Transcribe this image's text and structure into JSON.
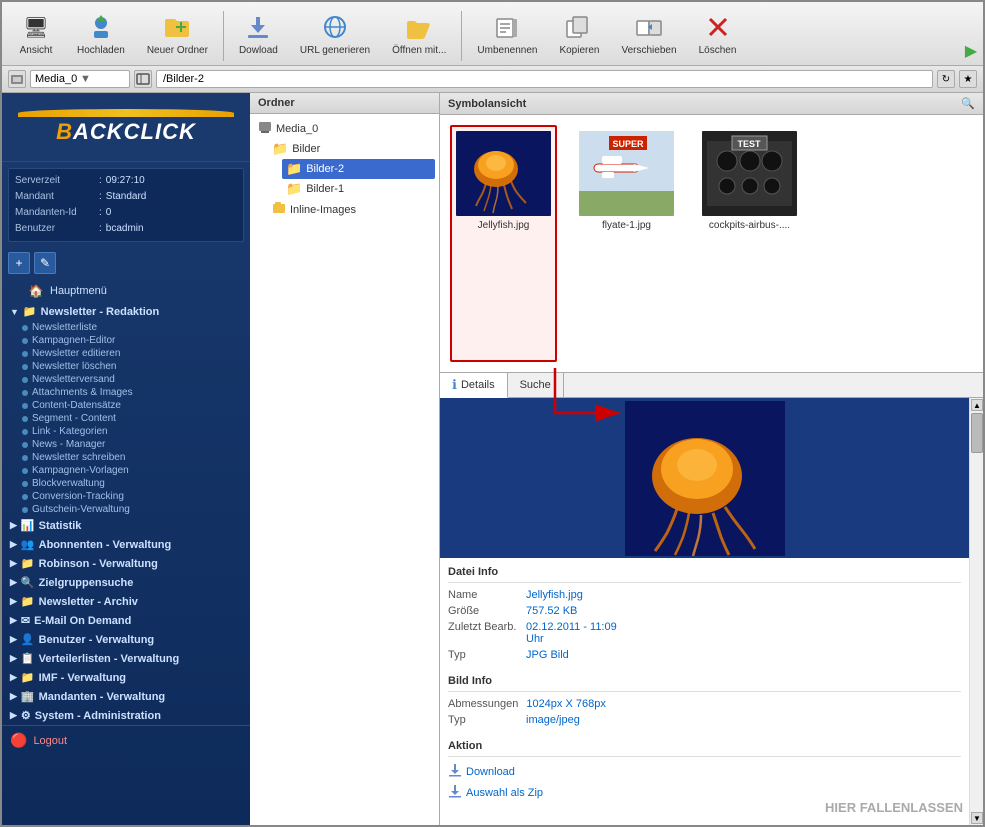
{
  "app": {
    "title": "BACKCLICK"
  },
  "toolbar": {
    "buttons": [
      {
        "id": "ansicht",
        "label": "Ansicht",
        "icon": "🖥"
      },
      {
        "id": "hochladen",
        "label": "Hochladen",
        "icon": "👤"
      },
      {
        "id": "neuer-ordner",
        "label": "Neuer Ordner",
        "icon": "📁"
      },
      {
        "id": "download",
        "label": "Dowload",
        "icon": "⬇"
      },
      {
        "id": "url",
        "label": "URL generieren",
        "icon": "🔗"
      },
      {
        "id": "oeffnen",
        "label": "Öffnen mit...",
        "icon": "📂"
      },
      {
        "id": "umbenennen",
        "label": "Umbenennen",
        "icon": "🖊"
      },
      {
        "id": "kopieren",
        "label": "Kopieren",
        "icon": "📋"
      },
      {
        "id": "verschieben",
        "label": "Verschieben",
        "icon": "➡"
      },
      {
        "id": "loeschen",
        "label": "Löschen",
        "icon": "❌"
      }
    ]
  },
  "address_bar": {
    "dropdown_value": "Media_0",
    "path_value": "/Bilder-2"
  },
  "server_info": {
    "rows": [
      {
        "label": "Serverzeit",
        "separator": ":",
        "value": "09:27:10"
      },
      {
        "label": "Mandant",
        "separator": ":",
        "value": "Standard"
      },
      {
        "label": "Mandanten-Id",
        "separator": ":",
        "value": "0"
      },
      {
        "label": "Benutzer",
        "separator": ":",
        "value": "bcadmin"
      }
    ]
  },
  "sidebar": {
    "hauptmenu_label": "Hauptmenü",
    "groups": [
      {
        "id": "newsletter",
        "label": "Newsletter - Redaktion",
        "expanded": true,
        "subitems": [
          "Newsletterliste",
          "Kampagnen-Editor",
          "Newsletter editieren",
          "Newsletter löschen",
          "Newsletterversand",
          "Attachments & Images",
          "Content-Datensätze",
          "Segment - Content",
          "Link - Kategorien",
          "News - Manager",
          "Newsletter schreiben",
          "Kampagnen-Vorlagen",
          "Blockverwaltung",
          "Conversion-Tracking",
          "Gutschein-Verwaltung"
        ]
      },
      {
        "id": "statistik",
        "label": "Statistik",
        "expanded": false
      },
      {
        "id": "abonnenten",
        "label": "Abonnenten - Verwaltung",
        "expanded": false
      },
      {
        "id": "robinson",
        "label": "Robinson - Verwaltung",
        "expanded": false
      },
      {
        "id": "zielgruppe",
        "label": "Zielgruppensuche",
        "expanded": false
      },
      {
        "id": "newsletter-archiv",
        "label": "Newsletter - Archiv",
        "expanded": false
      },
      {
        "id": "email-demand",
        "label": "E-Mail On Demand",
        "expanded": false
      },
      {
        "id": "benutzer",
        "label": "Benutzer - Verwaltung",
        "expanded": false
      },
      {
        "id": "verteilerlisten",
        "label": "Verteilerlisten - Verwaltung",
        "expanded": false
      },
      {
        "id": "imf",
        "label": "IMF - Verwaltung",
        "expanded": false
      },
      {
        "id": "mandanten",
        "label": "Mandanten - Verwaltung",
        "expanded": false
      },
      {
        "id": "system",
        "label": "System - Administration",
        "expanded": false
      }
    ],
    "logout_label": "Logout"
  },
  "folder_panel": {
    "header": "Ordner",
    "items": [
      {
        "id": "media0",
        "label": "Media_0",
        "level": 0,
        "icon": "💾"
      },
      {
        "id": "bilder",
        "label": "Bilder",
        "level": 1,
        "icon": "📁"
      },
      {
        "id": "bilder2",
        "label": "Bilder-2",
        "level": 2,
        "icon": "📁",
        "selected": true
      },
      {
        "id": "bilder1",
        "label": "Bilder-1",
        "level": 2,
        "icon": "📁"
      },
      {
        "id": "inline",
        "label": "Inline-Images",
        "level": 1,
        "icon": "📁"
      }
    ]
  },
  "symbol_view": {
    "header": "Symbolansicht",
    "files": [
      {
        "id": "jellyfish",
        "label": "Jellyfish.jpg",
        "selected": true
      },
      {
        "id": "flyate",
        "label": "flyate-1.jpg",
        "selected": false
      },
      {
        "id": "cockpits",
        "label": "cockpits-airbus-....",
        "selected": false
      }
    ]
  },
  "details_panel": {
    "tabs": [
      {
        "id": "details",
        "label": "Details",
        "active": true,
        "has_icon": true
      },
      {
        "id": "suche",
        "label": "Suche",
        "active": false
      }
    ],
    "file_info": {
      "section_title": "Datei Info",
      "rows": [
        {
          "label": "Name",
          "value": "Jellyfish.jpg"
        },
        {
          "label": "Größe",
          "value": "757.52 KB"
        },
        {
          "label": "Zuletzt Bearb.",
          "value": "02.12.2011 - 11:09 Uhr"
        },
        {
          "label": "Typ",
          "value": "JPG Bild"
        }
      ]
    },
    "bild_info": {
      "section_title": "Bild Info",
      "rows": [
        {
          "label": "Abmessungen",
          "value": "1024px X 768px"
        },
        {
          "label": "Typ",
          "value": "image/jpeg"
        }
      ]
    },
    "aktion": {
      "section_title": "Aktion",
      "items": [
        {
          "label": "Download",
          "icon": "⬇"
        },
        {
          "label": "Auswahl als Zip",
          "icon": "📦"
        }
      ]
    }
  },
  "drop_zone_text": "HIER FALLENLASSEN"
}
